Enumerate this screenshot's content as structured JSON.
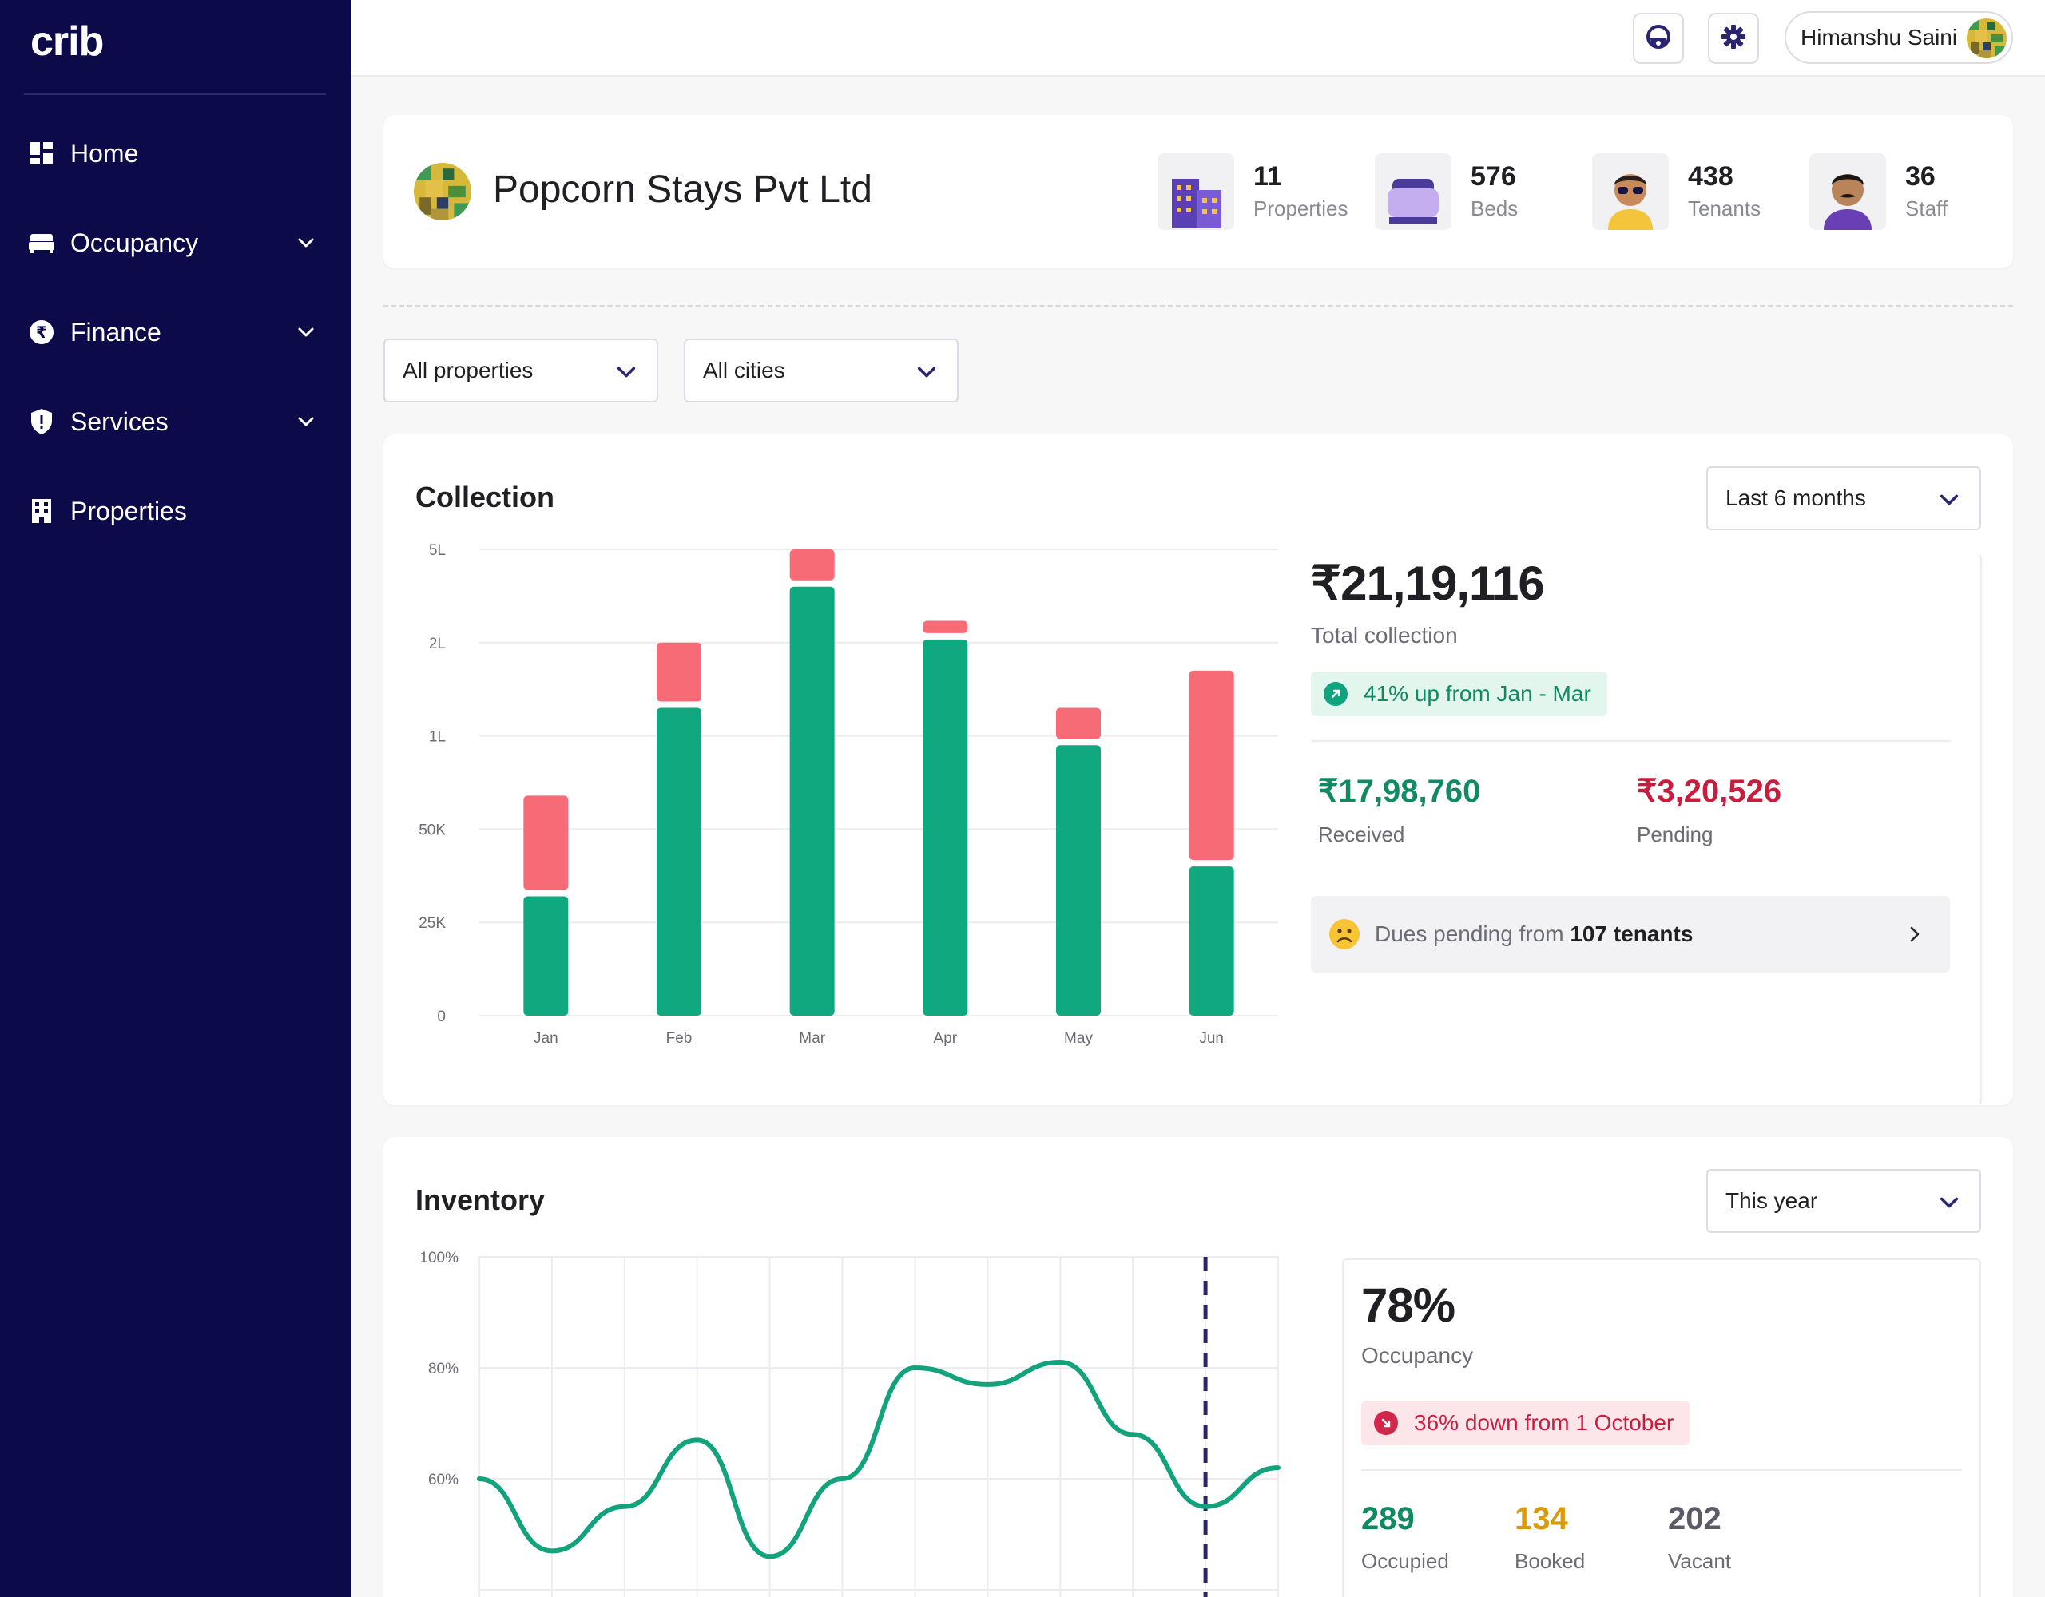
{
  "sidebar": {
    "logo": "crib",
    "items": [
      {
        "label": "Home",
        "icon": "dashboard-icon"
      },
      {
        "label": "Occupancy",
        "icon": "bed-icon"
      },
      {
        "label": "Finance",
        "icon": "rupee-icon"
      },
      {
        "label": "Services",
        "icon": "shield-icon"
      },
      {
        "label": "Properties",
        "icon": "building-icon"
      }
    ]
  },
  "topbar": {
    "user_name": "Himanshu Saini"
  },
  "company": {
    "name": "Popcorn Stays Pvt Ltd",
    "stats": [
      {
        "value": "11",
        "label": "Properties"
      },
      {
        "value": "576",
        "label": "Beds"
      },
      {
        "value": "438",
        "label": "Tenants"
      },
      {
        "value": "36",
        "label": "Staff"
      }
    ]
  },
  "filters": {
    "properties": "All properties",
    "cities": "All cities"
  },
  "collection": {
    "title": "Collection",
    "period": "Last 6 months",
    "total": "₹21,19,116",
    "total_label": "Total collection",
    "trend": "41% up from Jan - Mar",
    "received": "₹17,98,760",
    "received_label": "Received",
    "pending": "₹3,20,526",
    "pending_label": "Pending",
    "dues_prefix": "Dues pending from ",
    "dues_count": "107 tenants"
  },
  "inventory": {
    "title": "Inventory",
    "period": "This year",
    "occupancy": "78%",
    "occupancy_label": "Occupancy",
    "trend": "36% down from 1 October",
    "occupied": "289",
    "occupied_label": "Occupied",
    "booked": "134",
    "booked_label": "Booked",
    "vacant": "202",
    "vacant_label": "Vacant"
  },
  "colors": {
    "sidebar_bg": "#0d0a4a",
    "received": "#10a97f",
    "pending": "#f76b76",
    "received_text": "#0f8a63",
    "pending_text": "#c81d3f",
    "booked_text": "#d99a0b",
    "vacant_text": "#5b5b66",
    "line": "#12a37c",
    "marker": "#2b2470"
  },
  "chart_data": [
    {
      "type": "bar",
      "stacked": true,
      "categories": [
        "Jan",
        "Feb",
        "Mar",
        "Apr",
        "May",
        "Jun"
      ],
      "y_ticks": [
        "0",
        "25K",
        "50K",
        "1L",
        "2L",
        "5L"
      ],
      "series": [
        {
          "name": "Received",
          "values": [
            32000,
            130000,
            380000,
            210000,
            95000,
            40000
          ]
        },
        {
          "name": "Pending",
          "values": [
            36000,
            70000,
            120000,
            60000,
            35000,
            130000
          ]
        }
      ],
      "grid": true,
      "legend": "none"
    },
    {
      "type": "line",
      "x_count": 12,
      "y_ticks": [
        "100%",
        "80%",
        "60%"
      ],
      "ylim": [
        40,
        100
      ],
      "values": [
        60,
        47,
        55,
        67,
        46,
        60,
        80,
        77,
        81,
        68,
        55,
        62
      ],
      "marker_index": 10,
      "grid": true
    }
  ]
}
